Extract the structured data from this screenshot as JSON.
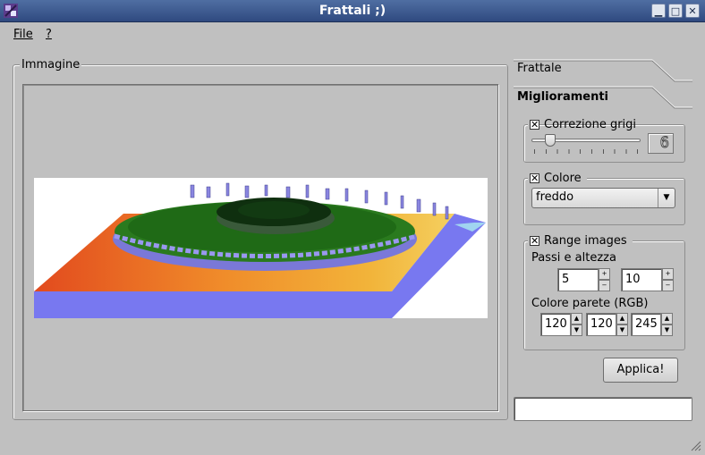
{
  "window": {
    "title": "Frattali ;)"
  },
  "menu": {
    "file": "File",
    "help": "?"
  },
  "image_group": {
    "title": "Immagine"
  },
  "tabs": {
    "frattale": "Frattale",
    "miglioramenti": "Miglioramenti"
  },
  "grayscale": {
    "label": "Correzione grigi",
    "checked": true,
    "lcd_value": "6",
    "slider_level": 0.14
  },
  "color": {
    "label": "Colore",
    "checked": true,
    "selected": "freddo"
  },
  "range": {
    "label": "Range images",
    "checked": true,
    "steps_label": "Passi e altezza",
    "steps": "5",
    "height": "10",
    "wall_label": "Colore parete (RGB)",
    "r": "120",
    "g": "120",
    "b": "245"
  },
  "apply_label": "Applica!",
  "status_text": ""
}
